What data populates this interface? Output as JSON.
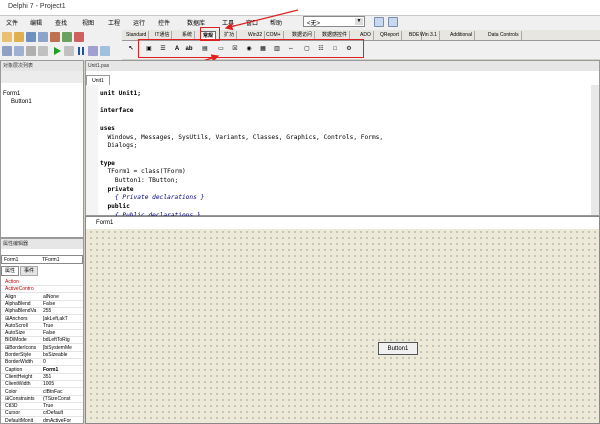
{
  "title": "Delphi 7 - Project1",
  "menu": [
    "文件",
    "编辑",
    "查找",
    "视图",
    "工程",
    "运行",
    "控件",
    "数据库",
    "工具",
    "窗口",
    "帮助"
  ],
  "dropdown_value": "<无>",
  "palette_tabs": [
    "Standard",
    "IT通信",
    "系统",
    "常规",
    "扩功",
    "Win32",
    "COM+",
    "数据访问",
    "数据感控件",
    "ADO",
    "QReport",
    "BDE",
    "Win 3.1",
    "Additional",
    "Data Controls"
  ],
  "active_palette_tab": "常规",
  "tree": {
    "header": "对象层次列表",
    "items": [
      "Form1",
      "Button1"
    ]
  },
  "editor": {
    "header": "Unit1.pas",
    "tab": "Unit1",
    "lines": [
      "unit Unit1;",
      "",
      "interface",
      "",
      "uses",
      "  Windows, Messages, SysUtils, Variants, Classes, Graphics, Controls, Forms,",
      "  Dialogs;",
      "",
      "type",
      "  TForm1 = class(TForm)",
      "    Button1: TButton;",
      "  private",
      "    { Private declarations }",
      "  public",
      "    { Public declarations }"
    ]
  },
  "inspector": {
    "header": "属性编辑器",
    "object_name": "Form1",
    "object_type": "TForm1",
    "tabs": [
      "属性",
      "事件"
    ],
    "props": [
      [
        "Action",
        ""
      ],
      [
        "ActiveContro",
        ""
      ],
      [
        "Align",
        "alNone"
      ],
      [
        "AlphaBlend",
        "False"
      ],
      [
        "AlphaBlendVa",
        "255"
      ],
      [
        "⊞Anchors",
        "[akLeft,akT"
      ],
      [
        "AutoScroll",
        "True"
      ],
      [
        "AutoSize",
        "False"
      ],
      [
        "BiDiMode",
        "bdLeftToRig"
      ],
      [
        "⊞BorderIcons",
        "[biSystemMe"
      ],
      [
        "BorderStyle",
        "bsSizeable"
      ],
      [
        "BorderWidth",
        "0"
      ],
      [
        "Caption",
        "Form1"
      ],
      [
        "ClientHeight",
        "351"
      ],
      [
        "ClientWidth",
        "1005"
      ],
      [
        "Color",
        "clBtnFac"
      ],
      [
        "⊞Constraints",
        "(TSizeConst"
      ],
      [
        "Ctl3D",
        "True"
      ],
      [
        "Cursor",
        "crDefault"
      ],
      [
        "DefaultMonit",
        "dmActiveFor"
      ]
    ]
  },
  "form": {
    "caption": "Form1",
    "button_label": "Button1"
  },
  "colors": {
    "annotation": "#e02020",
    "keyword_comment": "#000080"
  }
}
